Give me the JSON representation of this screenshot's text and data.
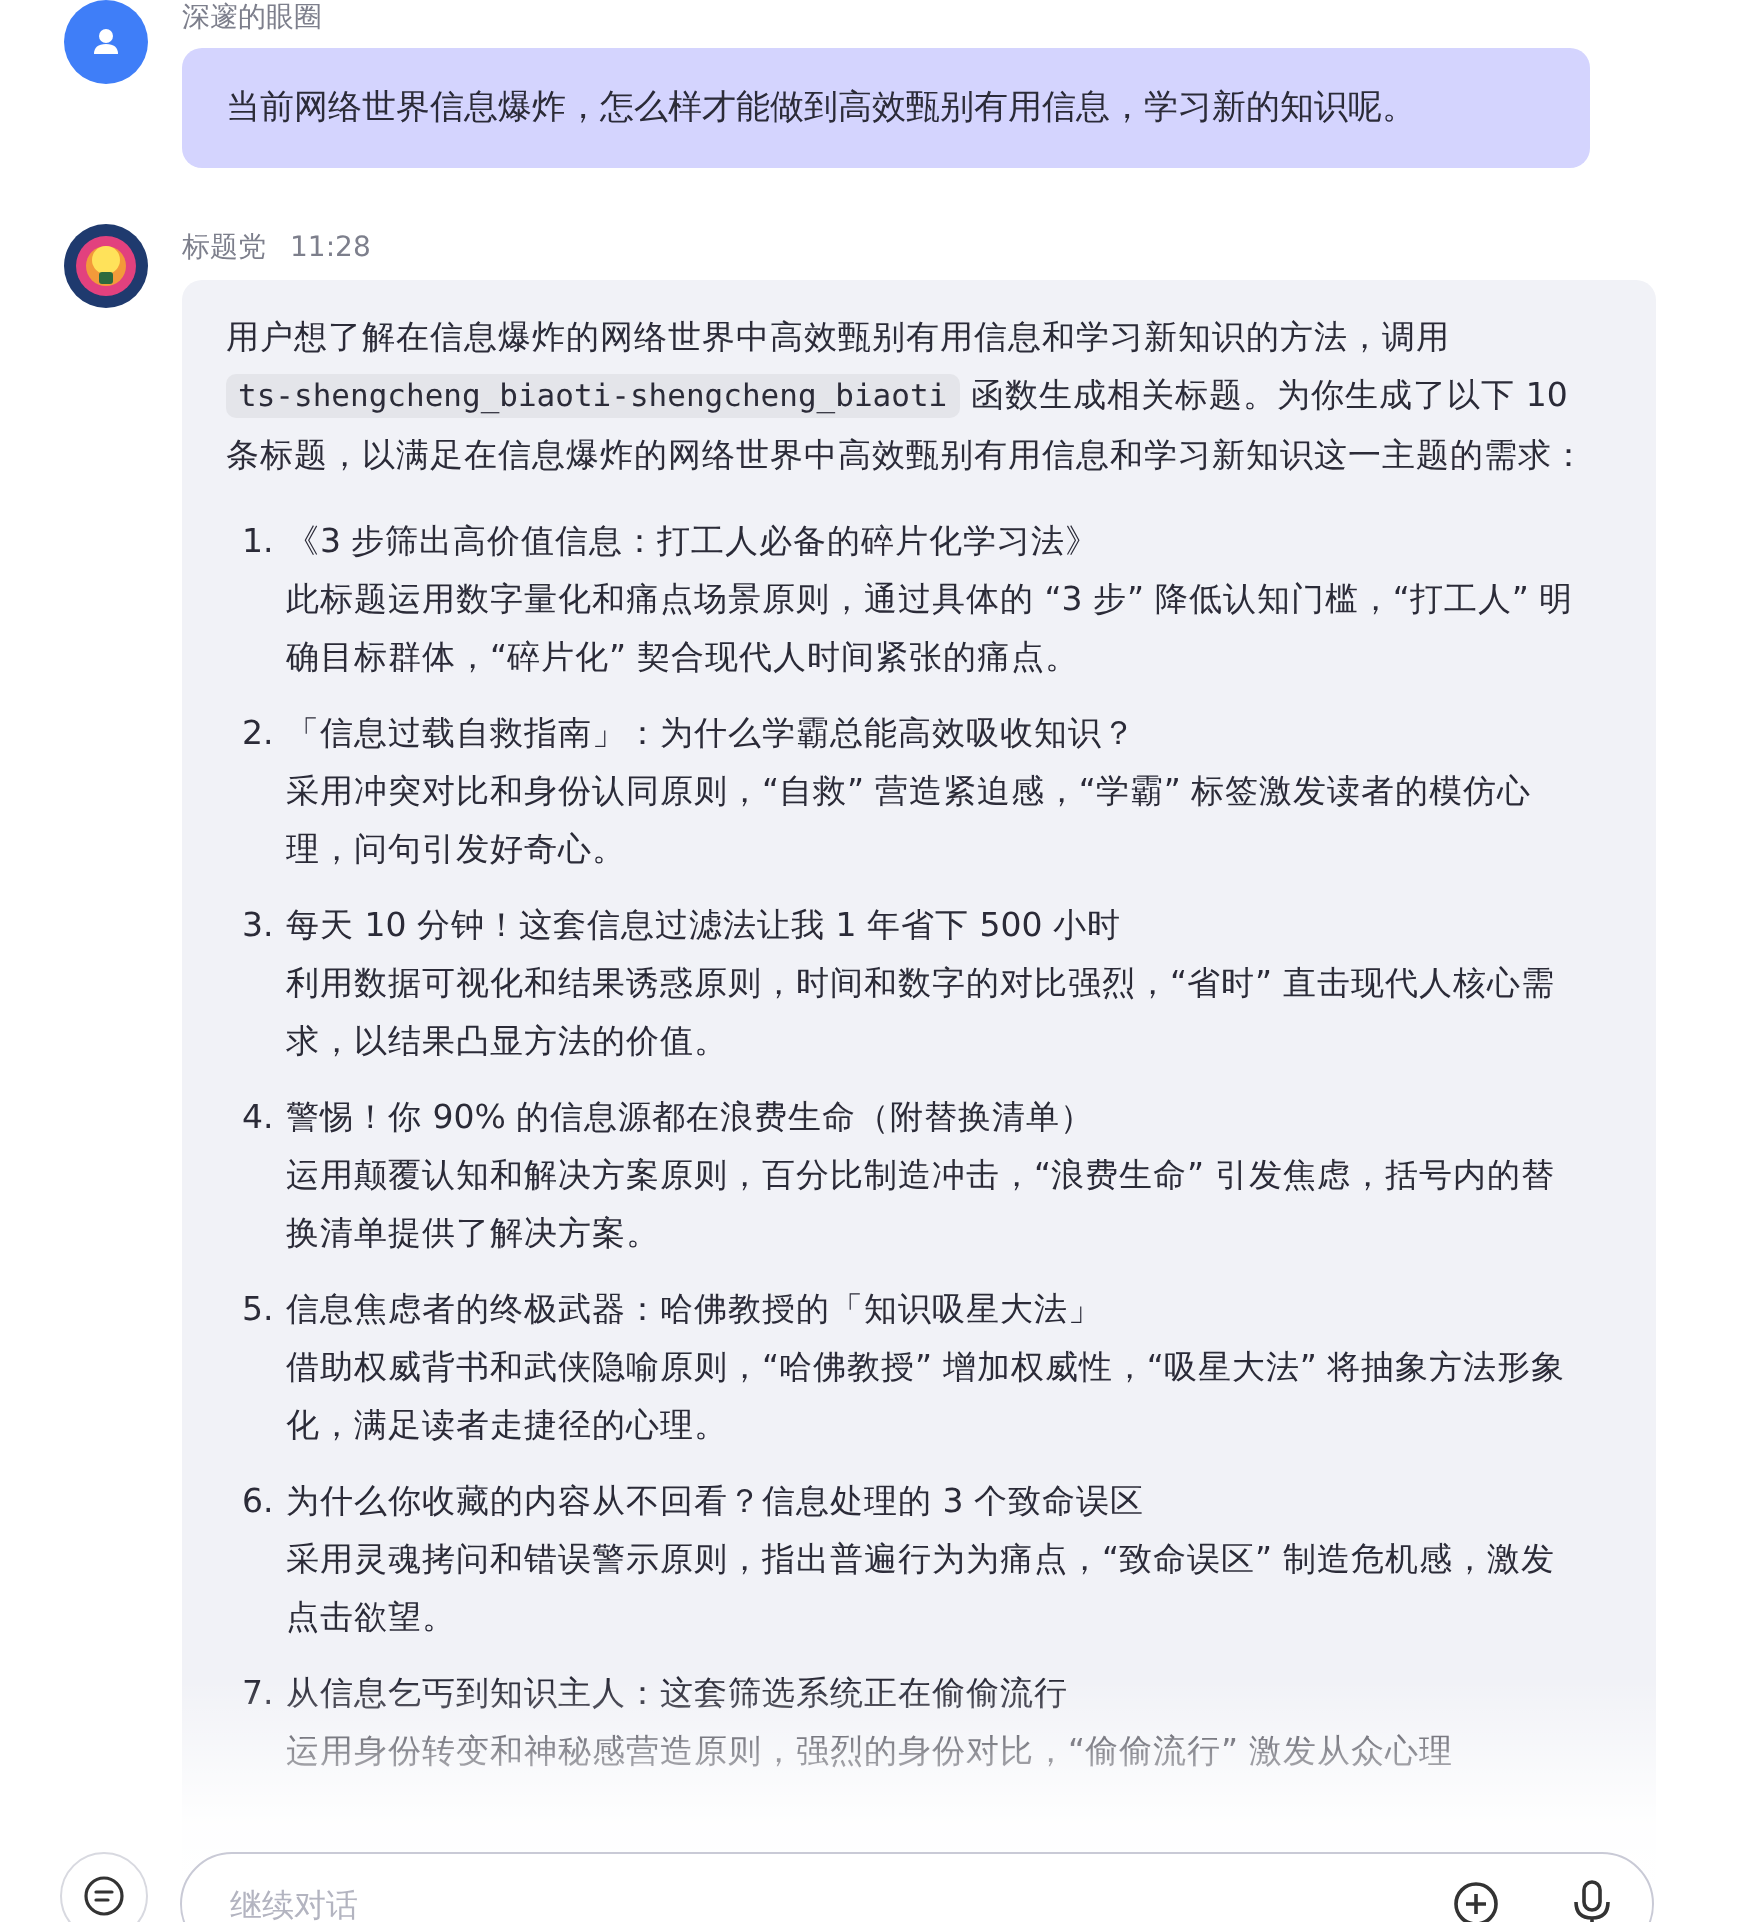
{
  "user_message": {
    "author": "深邃的眼圈",
    "text": "当前网络世界信息爆炸，怎么样才能做到高效甄别有用信息，学习新的知识呢。"
  },
  "bot_message": {
    "author": "标题党",
    "time": "11:28",
    "intro": {
      "before": "用户想了解在信息爆炸的网络世界中高效甄别有用信息和学习新知识的方法，调用",
      "code": "ts-shengcheng_biaoti-shengcheng_biaoti",
      "after": "函数生成相关标题。为你生成了以下 10 条标题，以满足在信息爆炸的网络世界中高效甄别有用信息和学习新知识这一主题的需求："
    },
    "items": [
      {
        "number": "1.",
        "title": "《3 步筛出高价值信息：打工人必备的碎片化学习法》",
        "description": "此标题运用数字量化和痛点场景原则，通过具体的 “3 步” 降低认知门槛，“打工人” 明确目标群体，“碎片化” 契合现代人时间紧张的痛点。"
      },
      {
        "number": "2.",
        "title": "「信息过载自救指南」：为什么学霸总能高效吸收知识？",
        "description": "采用冲突对比和身份认同原则，“自救” 营造紧迫感，“学霸” 标签激发读者的模仿心理，问句引发好奇心。"
      },
      {
        "number": "3.",
        "title": "每天 10 分钟！这套信息过滤法让我 1 年省下 500 小时",
        "description": "利用数据可视化和结果诱惑原则，时间和数字的对比强烈，“省时” 直击现代人核心需求，以结果凸显方法的价值。"
      },
      {
        "number": "4.",
        "title": "警惕！你 90% 的信息源都在浪费生命（附替换清单）",
        "description": "运用颠覆认知和解决方案原则，百分比制造冲击，“浪费生命” 引发焦虑，括号内的替换清单提供了解决方案。"
      },
      {
        "number": "5.",
        "title": "信息焦虑者的终极武器：哈佛教授的「知识吸星大法」",
        "description": "借助权威背书和武侠隐喻原则，“哈佛教授” 增加权威性，“吸星大法” 将抽象方法形象化，满足读者走捷径的心理。"
      },
      {
        "number": "6.",
        "title": "为什么你收藏的内容从不回看？信息处理的 3 个致命误区",
        "description": "采用灵魂拷问和错误警示原则，指出普遍行为为痛点，“致命误区” 制造危机感，激发点击欲望。"
      },
      {
        "number": "7.",
        "title": "从信息乞丐到知识主人：这套筛选系统正在偷偷流行",
        "description": "运用身份转变和神秘感营造原则，强烈的身份对比，“偷偷流行” 激发从众心理"
      }
    ]
  },
  "composer": {
    "placeholder": "继续对话"
  }
}
